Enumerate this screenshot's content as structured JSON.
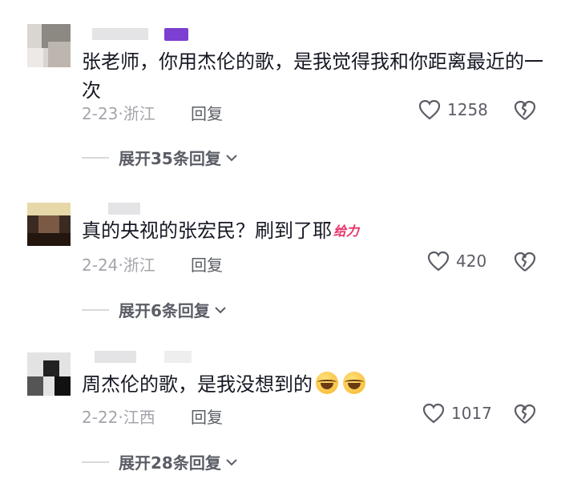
{
  "comments": [
    {
      "text": "张老师，你用杰伦的歌，是我觉得我和你距离最近的一次",
      "date": "2-23",
      "location": "浙江",
      "reply_label": "回复",
      "likes": "1258",
      "expand_label": "展开35条回复",
      "accent": "#7b3fd1"
    },
    {
      "text": "真的央视的张宏民？刷到了耶",
      "sticker": "给力",
      "date": "2-24",
      "location": "浙江",
      "reply_label": "回复",
      "likes": "420",
      "expand_label": "展开6条回复"
    },
    {
      "text": "周杰伦的歌，是我没想到的",
      "emojis": [
        "laughing-crying-emoji",
        "laughing-crying-emoji"
      ],
      "date": "2-22",
      "location": "江西",
      "reply_label": "回复",
      "likes": "1017",
      "expand_label": "展开28条回复"
    }
  ],
  "colors": {
    "primary_text": "#161823",
    "secondary_text": "#a3a5ab",
    "action_text": "#5b5d66"
  }
}
